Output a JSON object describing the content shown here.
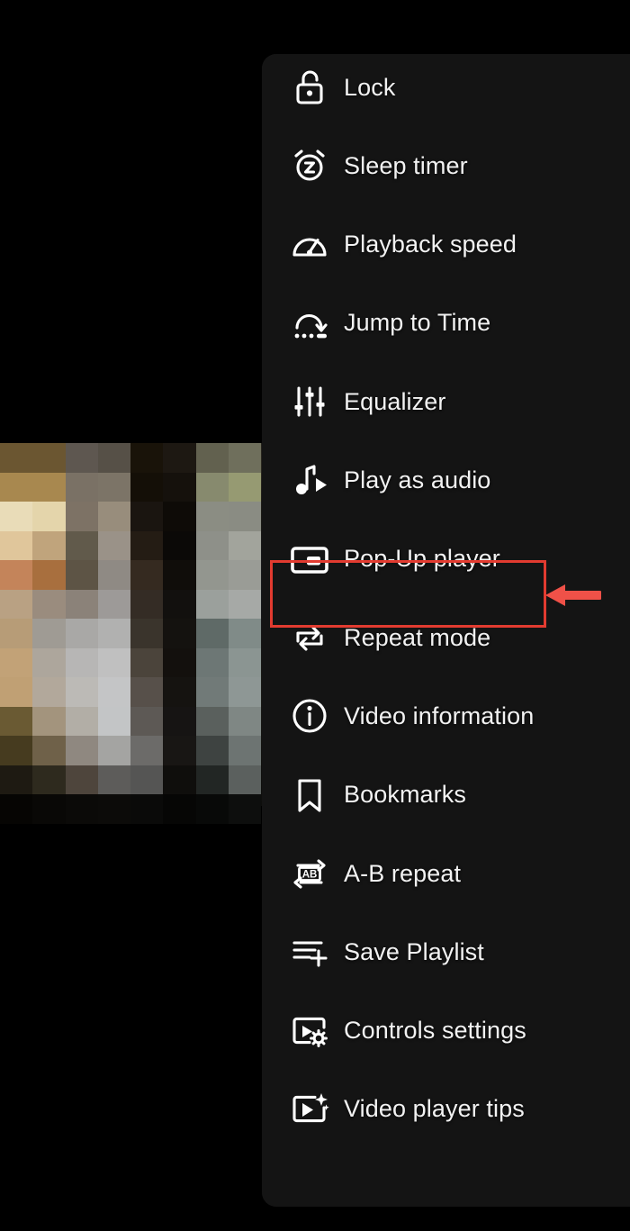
{
  "app": {
    "screen_name": "video-player-overflow-menu",
    "background_color": "#000000",
    "panel_color": "#141414",
    "label_color": "#f2f2f2",
    "accent_color": "#e23b30"
  },
  "menu": {
    "name": "player-options-menu",
    "items": [
      {
        "id": "lock",
        "label": "Lock",
        "icon": "lock-open-icon"
      },
      {
        "id": "sleep-timer",
        "label": "Sleep timer",
        "icon": "alarm-z-icon"
      },
      {
        "id": "playback-speed",
        "label": "Playback speed",
        "icon": "speedometer-icon"
      },
      {
        "id": "jump-to-time",
        "label": "Jump to Time",
        "icon": "jump-arc-arrow-icon"
      },
      {
        "id": "equalizer",
        "label": "Equalizer",
        "icon": "equalizer-sliders-icon"
      },
      {
        "id": "play-as-audio",
        "label": "Play as audio",
        "icon": "music-note-play-icon"
      },
      {
        "id": "pop-up-player",
        "label": "Pop-Up player",
        "icon": "picture-in-picture-icon"
      },
      {
        "id": "repeat-mode",
        "label": "Repeat mode",
        "icon": "repeat-icon"
      },
      {
        "id": "video-information",
        "label": "Video information",
        "icon": "info-circle-icon"
      },
      {
        "id": "bookmarks",
        "label": "Bookmarks",
        "icon": "bookmark-icon"
      },
      {
        "id": "ab-repeat",
        "label": "A-B repeat",
        "icon": "ab-repeat-icon"
      },
      {
        "id": "save-playlist",
        "label": "Save Playlist",
        "icon": "playlist-add-icon"
      },
      {
        "id": "controls-settings",
        "label": "Controls settings",
        "icon": "screen-gear-icon"
      },
      {
        "id": "video-player-tips",
        "label": "Video player tips",
        "icon": "screen-sparkle-icon"
      }
    ]
  },
  "annotation": {
    "highlight_target": "Pop-Up player",
    "highlight_color": "#e23b30",
    "arrow_direction": "left",
    "arrow_color": "#f05148"
  }
}
